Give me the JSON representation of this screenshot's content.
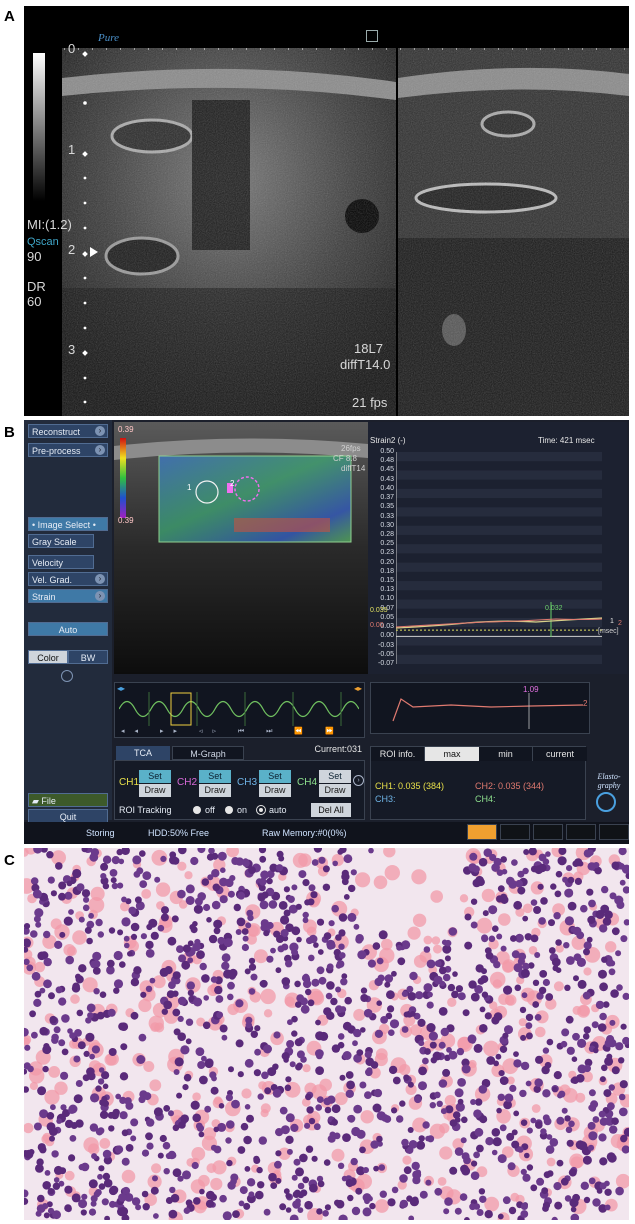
{
  "panels": {
    "a": {
      "label": "A",
      "brand": "Pure",
      "depth_marks": [
        "0",
        "1",
        "2",
        "3"
      ],
      "mi": "MI:(1.2)",
      "qscan": "Qscan",
      "qscan_value": "90",
      "dr": "DR",
      "dr_value": "60",
      "probe": "18L7",
      "difft": "diffT14.0",
      "fps": "21 fps"
    },
    "b": {
      "label": "B",
      "side_buttons": {
        "reconstruct": "Reconstruct",
        "preprocess": "Pre-process",
        "image_select": "Image Select",
        "gray_scale": "Gray Scale",
        "velocity": "Velocity",
        "vel_grad": "Vel. Grad.",
        "strain": "Strain",
        "auto": "Auto",
        "color": "Color",
        "bw": "BW",
        "file": "File",
        "quit": "Quit"
      },
      "colorbar_top": "0.39",
      "colorbar_bottom": "0.39",
      "overlay": {
        "fps": "26fps",
        "cf": "CF 8.8",
        "diff": "diffT14",
        "roi1": "1",
        "roi2": "2"
      },
      "graph": {
        "title": "Strain2 (-)",
        "time": "Time: 421 msec",
        "y_ticks": [
          "0.50",
          "0.48",
          "0.45",
          "0.43",
          "0.40",
          "0.37",
          "0.35",
          "0.33",
          "0.30",
          "0.28",
          "0.25",
          "0.23",
          "0.20",
          "0.18",
          "0.15",
          "0.13",
          "0.10",
          "0.07",
          "0.05",
          "0.03",
          "0.00",
          "-0.03",
          "-0.05",
          "-0.07"
        ],
        "ann_035": "0.035",
        "ann_032": "0.032",
        "ann_000": "0.00",
        "unit": "[msec]",
        "ch_marks": [
          "1",
          "2"
        ]
      },
      "mini_graph": {
        "value": "1.09",
        "ch": "2"
      },
      "tabs": {
        "tca": "TCA",
        "mgraph": "M-Graph",
        "current": "Current:031"
      },
      "channels": {
        "ch1": "CH1",
        "ch2": "CH2",
        "ch3": "CH3",
        "ch4": "CH4",
        "set": "Set",
        "draw": "Draw",
        "colors": {
          "ch1": "#e8e04a",
          "ch2": "#d86ad8",
          "ch3": "#6fb4e6",
          "ch4": "#8ee08e"
        }
      },
      "roi_tracking": {
        "label": "ROI Tracking",
        "off": "off",
        "on": "on",
        "auto": "auto",
        "del_all": "Del All"
      },
      "roi_info": {
        "tabs": [
          "ROI info.",
          "max",
          "min",
          "current"
        ],
        "ch1": "CH1: 0.035 (384)",
        "ch2": "CH2: 0.035 (344)",
        "ch3": "CH3:",
        "ch4": "CH4:"
      },
      "elasto": "Elasto-graphy",
      "status": {
        "storing": "Storing",
        "hdd": "HDD:50% Free",
        "raw": "Raw Memory:#0(0%)"
      }
    },
    "c": {
      "label": "C"
    }
  }
}
